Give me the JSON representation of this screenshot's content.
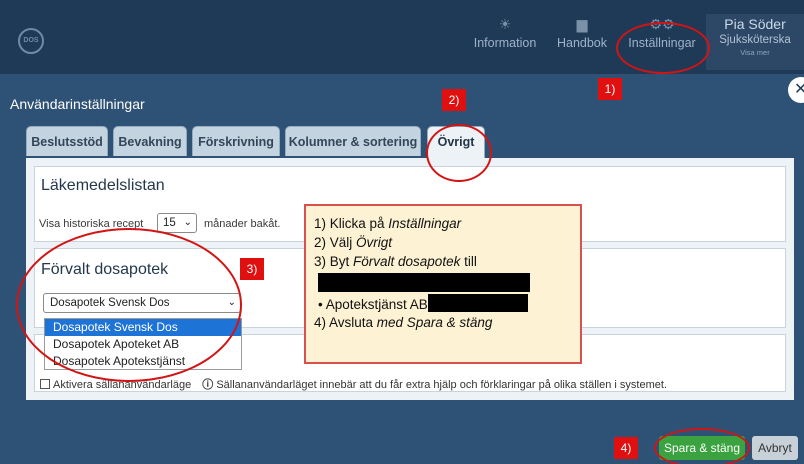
{
  "app": {
    "logo_text": "DOS"
  },
  "topnav": [
    {
      "label": "Information",
      "icon": "sun-icon"
    },
    {
      "label": "Handbok",
      "icon": "book-icon"
    },
    {
      "label": "Inställningar",
      "icon": "gears-icon"
    }
  ],
  "user": {
    "name": "Pia Söder",
    "role": "Sjuksköterska",
    "more": "Visa mer"
  },
  "dialog": {
    "title": "Användarinställningar",
    "close": "✕"
  },
  "tabs": [
    {
      "label": "Beslutsstöd"
    },
    {
      "label": "Bevakning"
    },
    {
      "label": "Förskrivning"
    },
    {
      "label": "Kolumner & sortering"
    },
    {
      "label": "Övrigt",
      "active": true
    }
  ],
  "lakemedel": {
    "title": "Läkemedelslistan",
    "history_label": "Visa historiska recept",
    "history_value": "15",
    "history_suffix": "månader bakåt."
  },
  "dosapotek": {
    "title": "Förvalt dosapotek",
    "selected": "Dosapotek Svensk Dos",
    "options": [
      "Dosapotek Svensk Dos",
      "Dosapotek  Apoteket AB",
      "Dosapotek Apotekstjänst"
    ]
  },
  "seldom": {
    "checkbox_label": "Aktivera sällananvändarläge",
    "info": "Sällananvändarläget innebär att du får extra hjälp och förklaringar på olika ställen i systemet."
  },
  "footer": {
    "save": "Spara & stäng",
    "cancel": "Avbryt"
  },
  "annotations": {
    "badges": [
      "1)",
      "2)",
      "3)",
      "4)"
    ],
    "callout": {
      "l1_prefix": "1) Klicka på ",
      "l1_em": "Inställningar",
      "l2_prefix": "2) Välj ",
      "l2_em": "Övrigt",
      "l3_prefix": "3) Byt ",
      "l3_em": "Förvalt dosapotek",
      "l3_suffix": " till",
      "bullet": "•   Apotekstjänst AB",
      "l4_prefix": "4) Avsluta ",
      "l4_em": "med Spara & stäng"
    },
    "accent_color": "#d21414"
  }
}
